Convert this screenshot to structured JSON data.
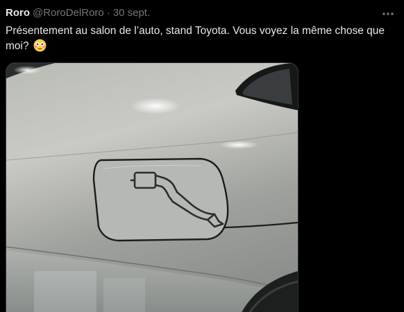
{
  "tweet": {
    "author": {
      "display_name": "Roro",
      "handle": "@RoroDelRoro"
    },
    "separator": "·",
    "timestamp": "30 sept.",
    "text": "Présentement au salon de l’auto, stand Toyota. Vous voyez la même chose que moi?",
    "emoji": "flushed-face-emoji",
    "more_icon": "more-horizontal-icon",
    "media": {
      "description_icon": "ev-charging-plug-icon"
    }
  },
  "colors": {
    "background": "#000000",
    "primary_text": "#e7e9ea",
    "secondary_text": "#71767b",
    "border": "#2f3336"
  }
}
